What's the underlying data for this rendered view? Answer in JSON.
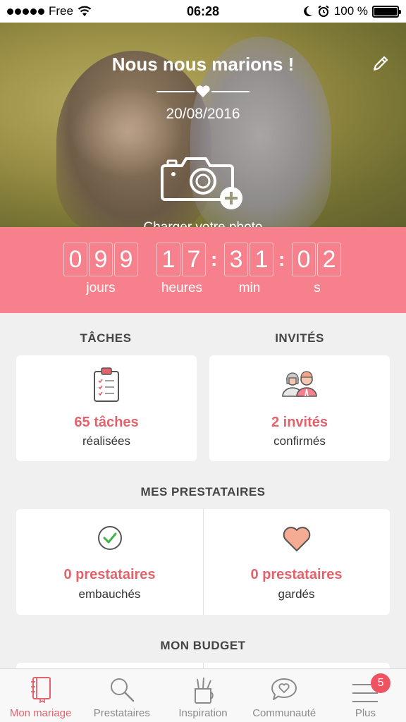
{
  "status_bar": {
    "carrier": "Free",
    "time": "06:28",
    "battery": "100 %"
  },
  "hero": {
    "title": "Nous nous marions !",
    "date": "20/08/2016",
    "upload_label": "Charger votre photo"
  },
  "countdown": {
    "days_digits": [
      "0",
      "9",
      "9"
    ],
    "hours_digits": [
      "1",
      "7"
    ],
    "minutes_digits": [
      "3",
      "1"
    ],
    "seconds_digits": [
      "0",
      "2"
    ],
    "labels": {
      "days": "jours",
      "hours": "heures",
      "minutes": "min",
      "seconds": "s"
    }
  },
  "tasks": {
    "title": "TÂCHES",
    "value": "65 tâches",
    "sub": "réalisées"
  },
  "guests": {
    "title": "INVITÉS",
    "value": "2 invités",
    "sub": "confirmés"
  },
  "vendors": {
    "title": "MES PRESTATAIRES",
    "hired": {
      "value": "0 prestataires",
      "sub": "embauchés"
    },
    "saved": {
      "value": "0 prestataires",
      "sub": "gardés"
    }
  },
  "budget": {
    "title": "MON BUDGET"
  },
  "tab_bar": {
    "tabs": [
      {
        "label": "Mon mariage",
        "icon": "notebook-icon",
        "active": true
      },
      {
        "label": "Prestataires",
        "icon": "search-icon",
        "active": false
      },
      {
        "label": "Inspiration",
        "icon": "pencil-cup-icon",
        "active": false
      },
      {
        "label": "Communauté",
        "icon": "chat-heart-icon",
        "active": false
      },
      {
        "label": "Plus",
        "icon": "menu-icon",
        "active": false,
        "badge": "5"
      }
    ]
  },
  "colors": {
    "accent": "#f6818c",
    "accent_text": "#e2636c",
    "badge": "#ef5261"
  }
}
